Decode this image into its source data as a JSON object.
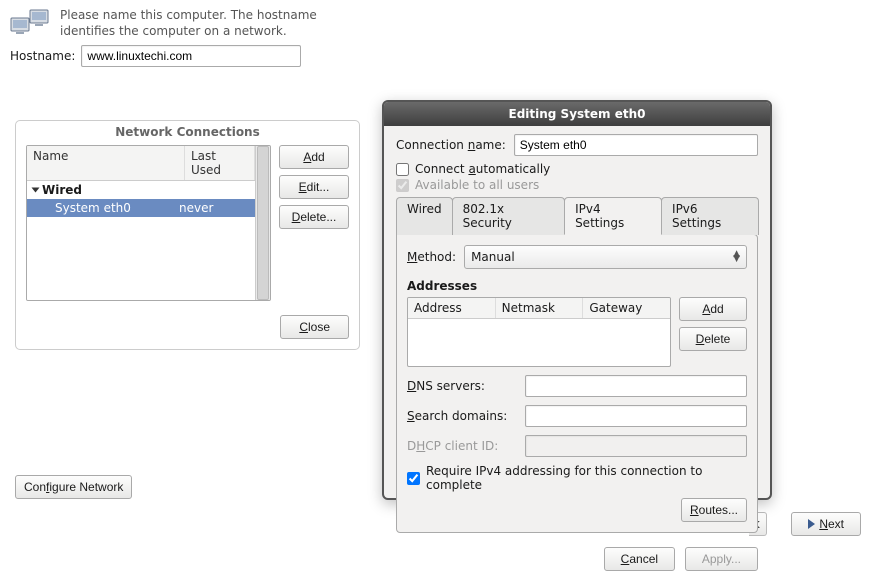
{
  "header": {
    "description": "Please name this computer.  The hostname identifies the computer on a network.",
    "hostname_label": "Hostname:",
    "hostname_value": "www.linuxtechi.com"
  },
  "nc_panel": {
    "title": "Network Connections",
    "columns": {
      "name": "Name",
      "last_used": "Last Used"
    },
    "group_label": "Wired",
    "items": [
      {
        "name": "System eth0",
        "last_used": "never"
      }
    ],
    "buttons": {
      "add": "Add",
      "edit": "Edit...",
      "delete": "Delete...",
      "close": "Close"
    }
  },
  "configure_network_label": "Configure Network",
  "footer": {
    "next": "Next",
    "back_stub": "k"
  },
  "dialog": {
    "title": "Editing System eth0",
    "connection_name_label": "Connection name:",
    "connection_name_value": "System eth0",
    "connect_automatically": {
      "label": "Connect automatically",
      "checked": false
    },
    "available_all": {
      "label": "Available to all users",
      "checked": true
    },
    "tabs": [
      "Wired",
      "802.1x Security",
      "IPv4 Settings",
      "IPv6 Settings"
    ],
    "active_tab": "IPv4 Settings",
    "ipv4": {
      "method_label": "Method:",
      "method_value": "Manual",
      "addresses_title": "Addresses",
      "addr_columns": {
        "address": "Address",
        "netmask": "Netmask",
        "gateway": "Gateway"
      },
      "add_label": "Add",
      "delete_label": "Delete",
      "dns_label": "DNS servers:",
      "search_label": "Search domains:",
      "dhcp_label": "DHCP client ID:",
      "require_label": "Require IPv4 addressing for this connection to complete",
      "routes_label": "Routes..."
    },
    "buttons": {
      "cancel": "Cancel",
      "apply": "Apply..."
    }
  }
}
